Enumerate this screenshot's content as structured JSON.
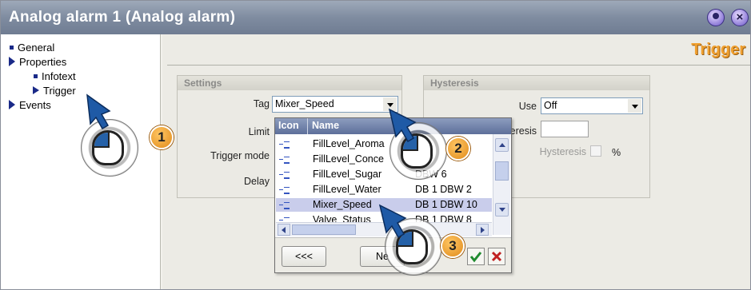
{
  "window": {
    "title": "Analog alarm 1 (Analog alarm)",
    "section_heading": "Trigger"
  },
  "tree": {
    "items": [
      {
        "label": "General",
        "icon": "square-bullet-icon"
      },
      {
        "label": "Properties",
        "icon": "expand-triangle-icon"
      },
      {
        "label": "Infotext",
        "icon": "square-bullet-icon"
      },
      {
        "label": "Trigger",
        "icon": "selected-arrow-icon"
      },
      {
        "label": "Events",
        "icon": "expand-triangle-icon"
      }
    ]
  },
  "settings": {
    "header": "Settings",
    "tag_label": "Tag",
    "tag_value": "Mixer_Speed",
    "limit_label": "Limit",
    "trigger_mode_label": "Trigger mode",
    "delay_label": "Delay"
  },
  "hysteresis": {
    "header": "Hysteresis",
    "use_label": "Use",
    "use_value": "Off",
    "hysteresis_label_partial": "eresis",
    "percent_label": "Hysteresis",
    "percent_symbol": "%"
  },
  "tag_popup": {
    "columns": [
      "Icon",
      "Name"
    ],
    "rows": [
      {
        "name": "FillLevel_Aroma",
        "address": ""
      },
      {
        "name": "FillLevel_Conce",
        "address": ""
      },
      {
        "name": "FillLevel_Sugar",
        "address": "DBW 6"
      },
      {
        "name": "FillLevel_Water",
        "address": "DB 1 DBW 2"
      },
      {
        "name": "Mixer_Speed",
        "address": "DB 1 DBW 10",
        "selected": true
      },
      {
        "name": "Valve_Status",
        "address": "DB 1 DBW 8"
      }
    ],
    "back_button": "<<<",
    "new_button": "Ne",
    "ok_icon": "check-icon",
    "cancel_icon": "x-icon"
  },
  "callouts": [
    "1",
    "2",
    "3"
  ],
  "colors": {
    "title_bar": "#7f8ca0",
    "trigger_heading": "#f0a030",
    "badge": "#f0a030",
    "tree_icon": "#1a2a88",
    "selected_row": "#c9cdeb"
  }
}
